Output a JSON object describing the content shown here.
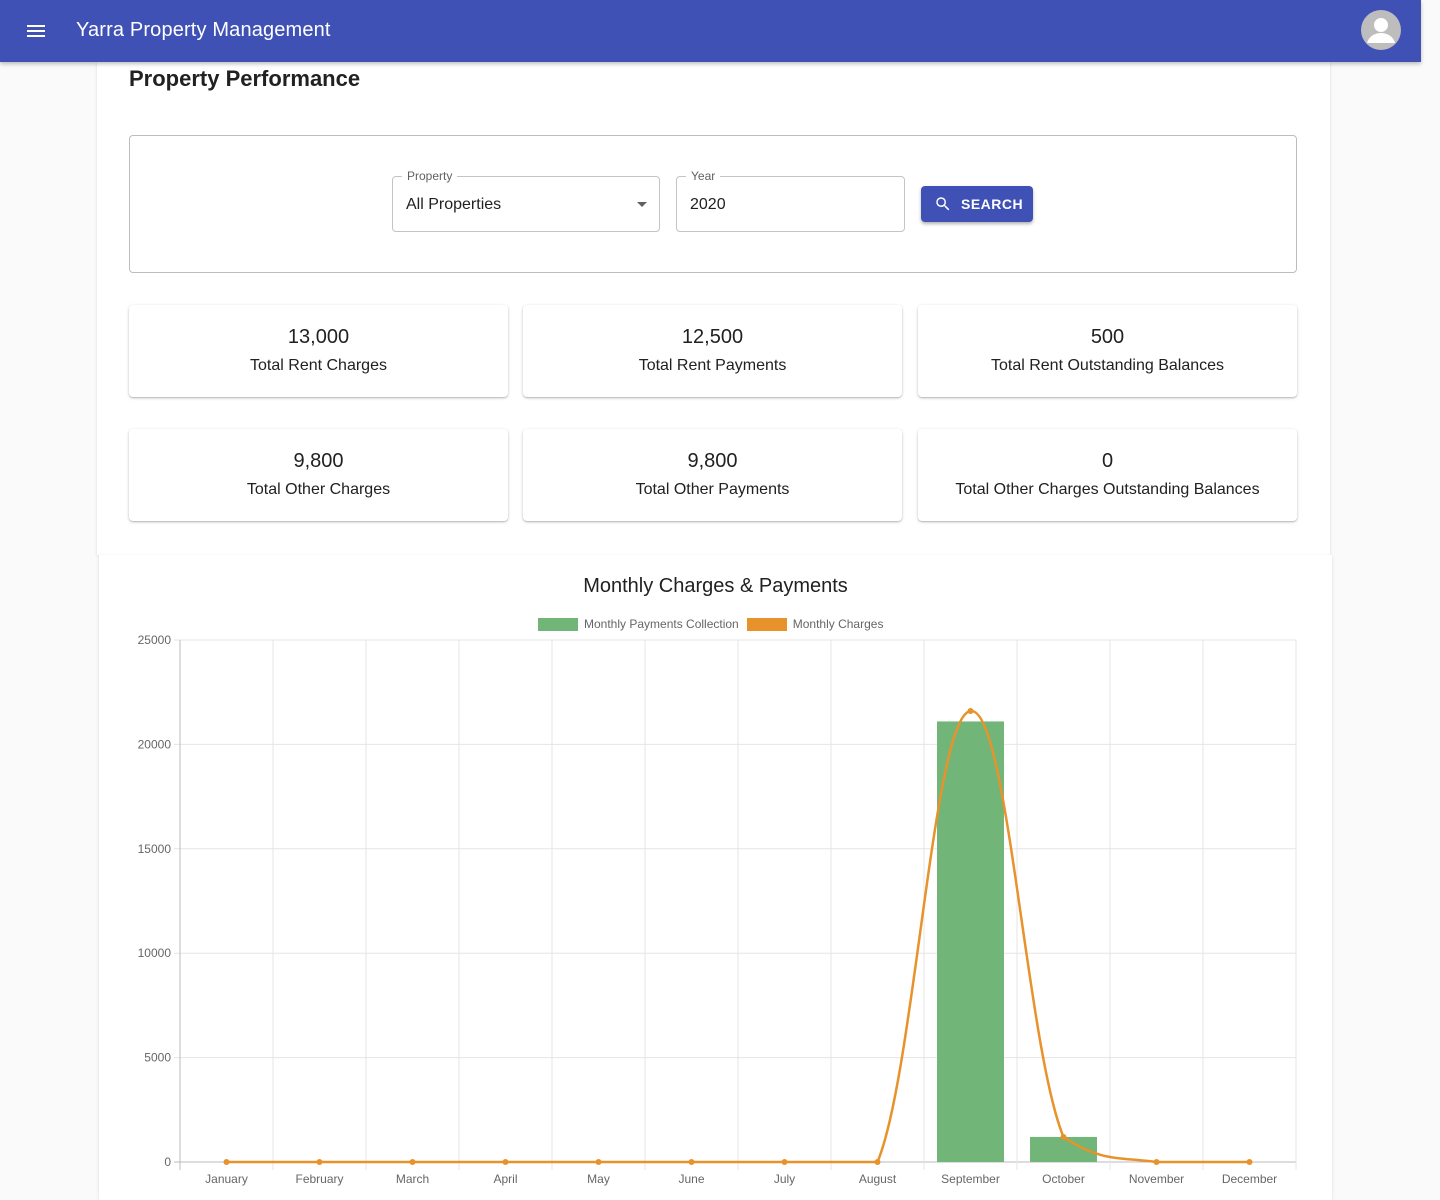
{
  "header": {
    "title": "Yarra Property Management"
  },
  "page": {
    "title": "Property Performance"
  },
  "filters": {
    "property": {
      "label": "Property",
      "value": "All Properties"
    },
    "year": {
      "label": "Year",
      "value": "2020"
    },
    "search_label": "SEARCH"
  },
  "cards": [
    {
      "value": "13,000",
      "label": "Total Rent Charges"
    },
    {
      "value": "12,500",
      "label": "Total Rent Payments"
    },
    {
      "value": "500",
      "label": "Total Rent Outstanding Balances"
    },
    {
      "value": "9,800",
      "label": "Total Other Charges"
    },
    {
      "value": "9,800",
      "label": "Total Other Payments"
    },
    {
      "value": "0",
      "label": "Total Other Charges Outstanding Balances"
    }
  ],
  "colors": {
    "appbar": "#3f51b5",
    "payments": "#72b578",
    "charges": "#e8922b"
  },
  "icons": {
    "menu": "menu-icon",
    "avatar": "account-circle-icon",
    "search": "search-icon"
  },
  "chart_data": {
    "type": "bar",
    "title": "Monthly Charges & Payments",
    "categories": [
      "January",
      "February",
      "March",
      "April",
      "May",
      "June",
      "July",
      "August",
      "September",
      "October",
      "November",
      "December"
    ],
    "series": [
      {
        "name": "Monthly Payments Collection",
        "type": "bar",
        "values": [
          0,
          0,
          0,
          0,
          0,
          0,
          0,
          0,
          21100,
          1200,
          0,
          0
        ]
      },
      {
        "name": "Monthly Charges",
        "type": "line",
        "values": [
          0,
          0,
          0,
          0,
          0,
          0,
          0,
          0,
          21600,
          1200,
          0,
          0
        ]
      }
    ],
    "ylim": [
      0,
      25000
    ],
    "yticks": [
      0,
      5000,
      10000,
      15000,
      20000,
      25000
    ],
    "grid": true,
    "legend": "top"
  }
}
